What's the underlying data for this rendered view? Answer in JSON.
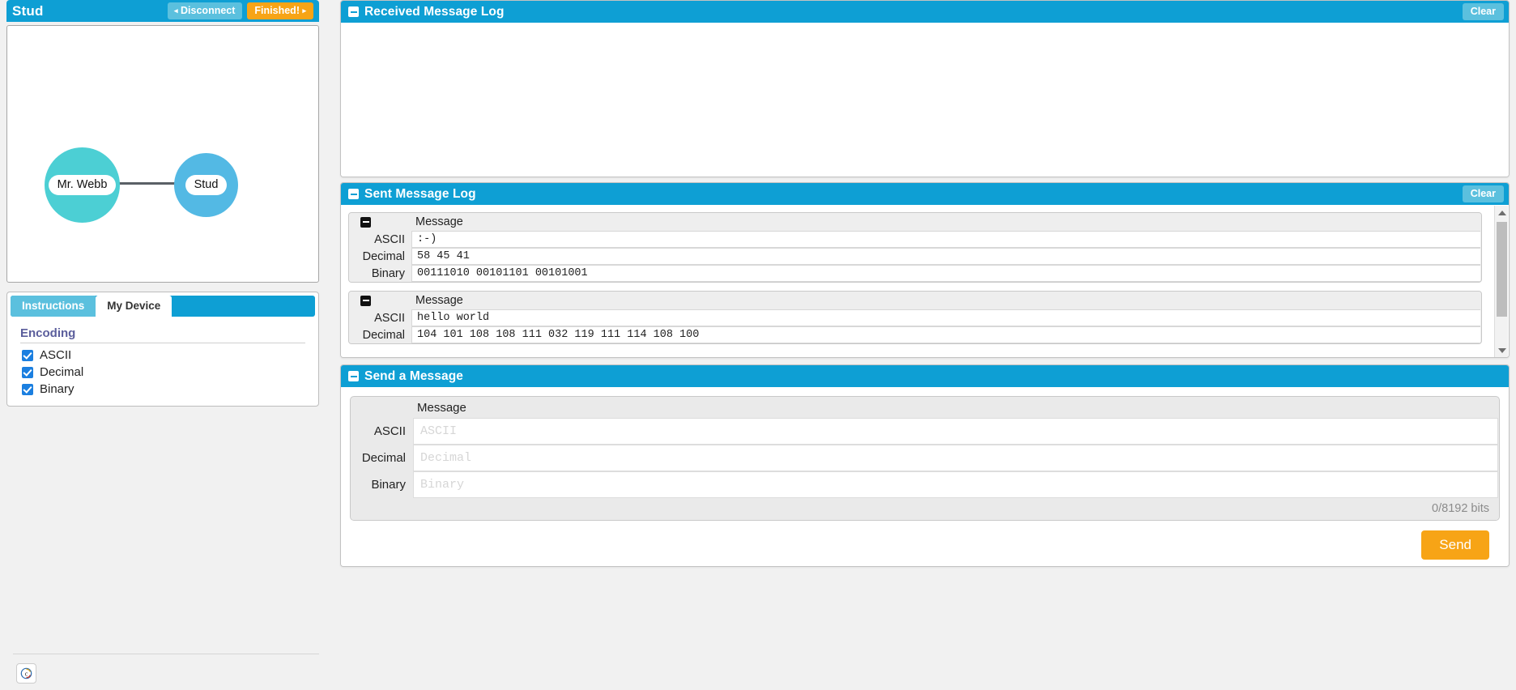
{
  "device": {
    "title": "Stud",
    "disconnect_label": "Disconnect",
    "finished_label": "Finished!",
    "arrow_left": "◂",
    "arrow_right": "▸"
  },
  "diagram": {
    "node_a": "Mr. Webb",
    "node_b": "Stud",
    "node_a_color": "#4ccfd4",
    "node_b_color": "#53b9e4",
    "link_color": "#5a6066"
  },
  "tabs": [
    {
      "label": "Instructions",
      "active": false
    },
    {
      "label": "My Device",
      "active": true
    }
  ],
  "encoding": {
    "title": "Encoding",
    "options": [
      {
        "label": "ASCII",
        "checked": true
      },
      {
        "label": "Decimal",
        "checked": true
      },
      {
        "label": "Binary",
        "checked": true
      }
    ]
  },
  "footer": {
    "copyright_icon": "copyright-icon"
  },
  "received_log": {
    "title": "Received Message Log",
    "clear_label": "Clear",
    "entries": []
  },
  "sent_log": {
    "title": "Sent Message Log",
    "clear_label": "Clear",
    "message_header": "Message",
    "row_labels": {
      "ascii": "ASCII",
      "decimal": "Decimal",
      "binary": "Binary"
    },
    "entries": [
      {
        "ascii": ":-)",
        "decimal": "58 45 41",
        "binary": "00111010 00101101 00101001"
      },
      {
        "ascii": "hello world",
        "decimal": "104 101 108 108 111 032 119 111 114 108 100",
        "binary": ""
      }
    ]
  },
  "send_message": {
    "title": "Send a Message",
    "message_header": "Message",
    "rows": [
      {
        "label": "ASCII",
        "value": "",
        "placeholder": "ASCII"
      },
      {
        "label": "Decimal",
        "value": "",
        "placeholder": "Decimal"
      },
      {
        "label": "Binary",
        "value": "",
        "placeholder": "Binary"
      }
    ],
    "bit_counter": "0/8192 bits",
    "send_label": "Send"
  },
  "colors": {
    "panel_header": "#0e9fd4",
    "accent_light_blue": "#5bc0de",
    "accent_orange": "#f7a416",
    "checkbox_blue": "#1b7fe0",
    "encoding_heading": "#5b5e9c"
  }
}
